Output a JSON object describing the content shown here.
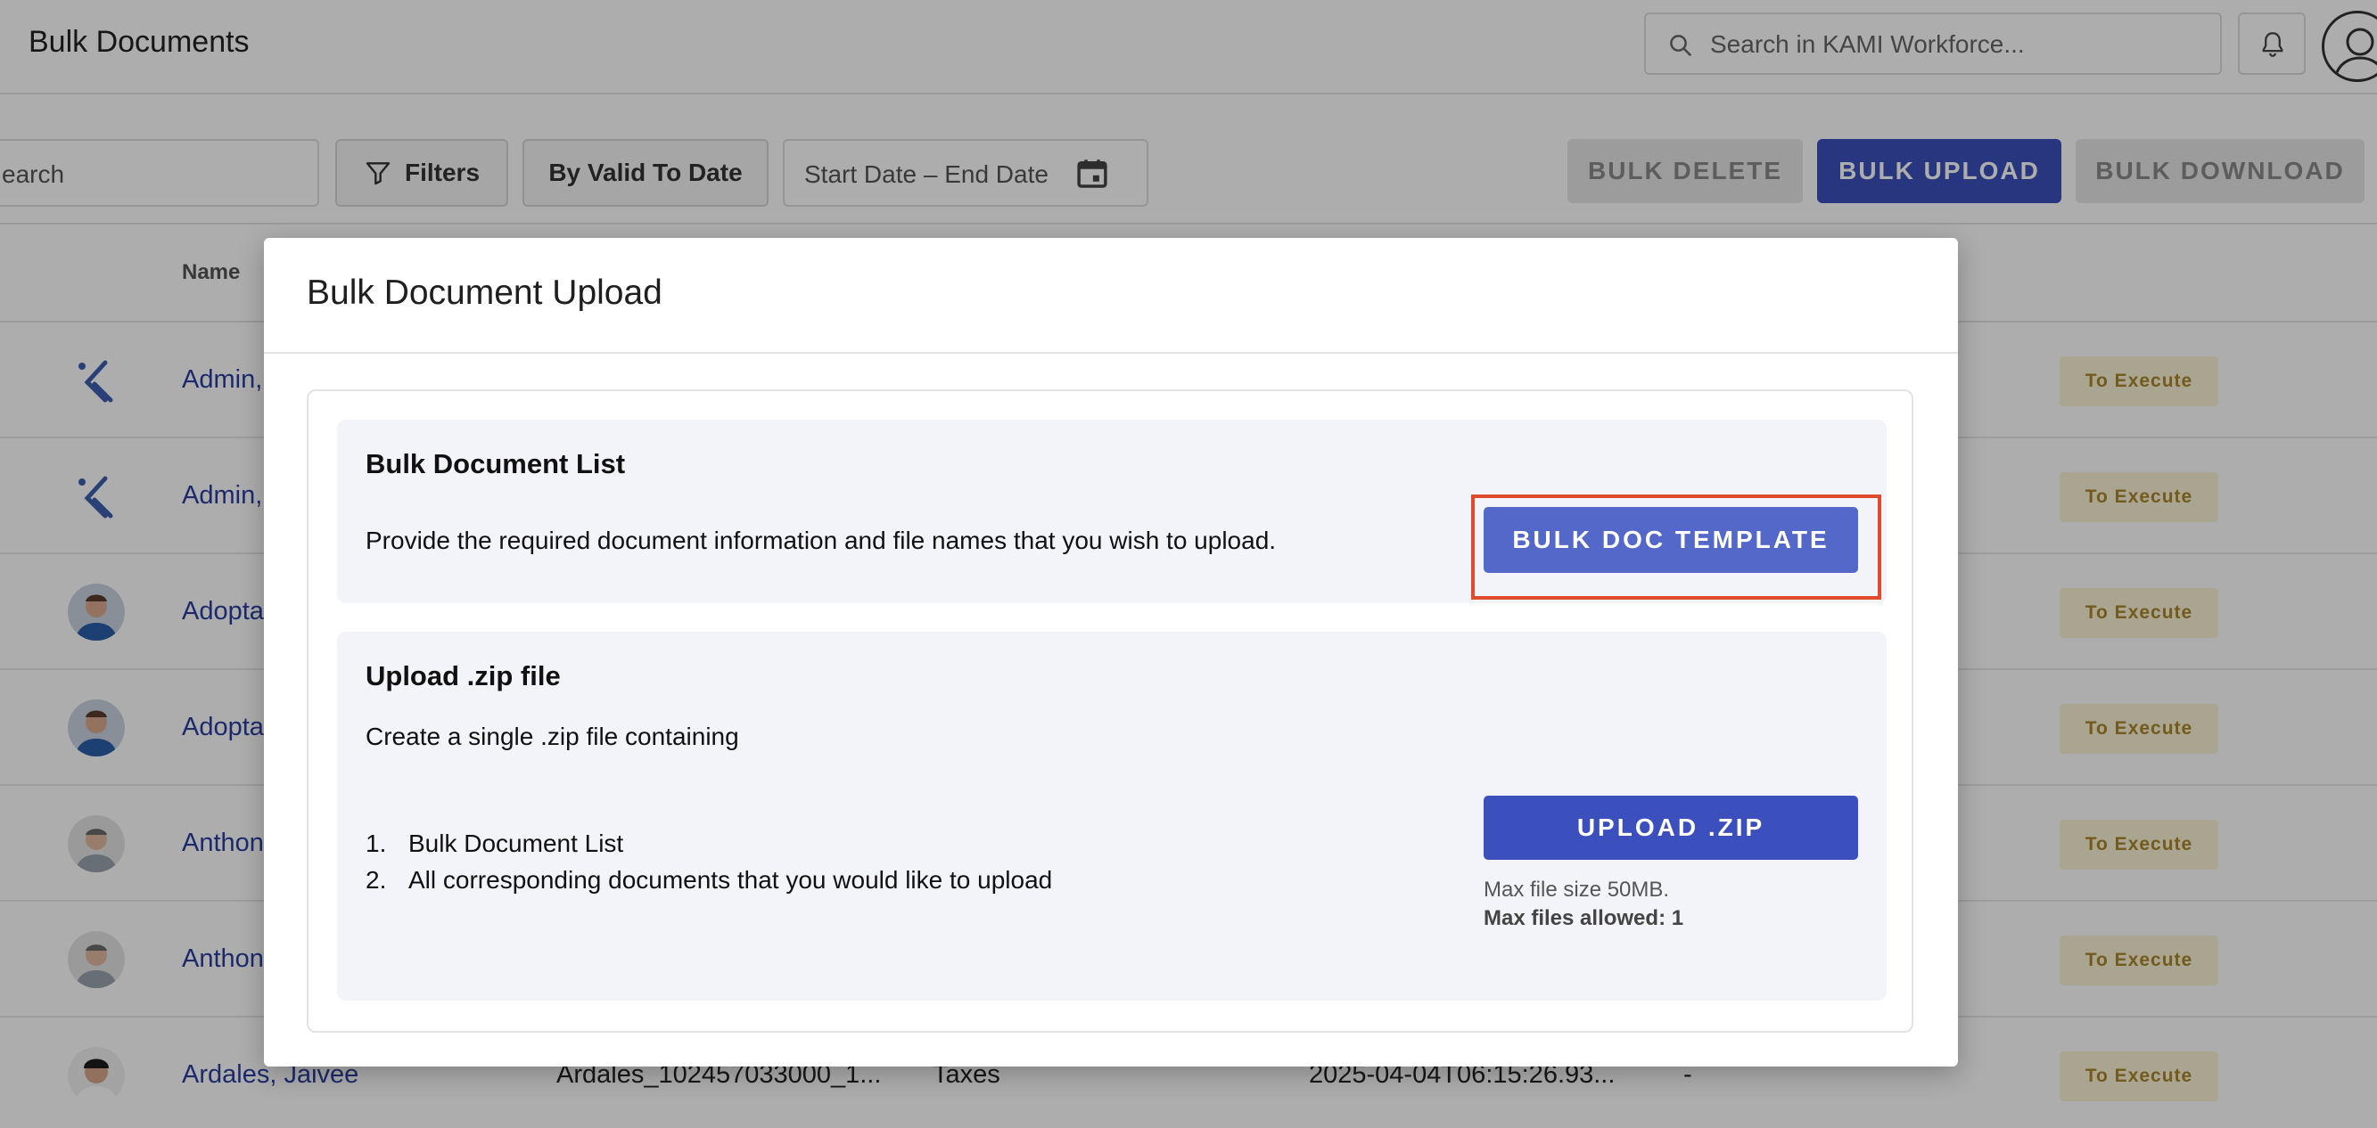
{
  "app": {
    "title": "Bulk Documents",
    "search_placeholder": "Search in KAMI Workforce..."
  },
  "toolbar": {
    "search_text": "earch",
    "filters_label": "Filters",
    "by_valid_label": "By Valid To Date",
    "date_start": "Start Date",
    "date_sep": "–",
    "date_end": "End Date",
    "bulk_delete": "BULK DELETE",
    "bulk_upload": "BULK UPLOAD",
    "bulk_download": "BULK DOWNLOAD"
  },
  "table": {
    "col_name": "Name",
    "rows": [
      {
        "name": "Admin,",
        "c2": "",
        "c3": "",
        "c4": "",
        "c5": "",
        "status": "To Execute"
      },
      {
        "name": "Admin,",
        "c2": "",
        "c3": "",
        "c4": "",
        "c5": "",
        "status": "To Execute"
      },
      {
        "name": "Adopta",
        "c2": "",
        "c3": "",
        "c4": "",
        "c5": "",
        "status": "To Execute"
      },
      {
        "name": "Adopta",
        "c2": "",
        "c3": "",
        "c4": "",
        "c5": "",
        "status": "To Execute"
      },
      {
        "name": "Anthon",
        "c2": "",
        "c3": "",
        "c4": "",
        "c5": "",
        "status": "To Execute"
      },
      {
        "name": "Anthon",
        "c2": "",
        "c3": "",
        "c4": "",
        "c5": "",
        "status": "To Execute"
      },
      {
        "name": "Ardales, Jaivee",
        "c2": "Ardales_102457033000_1...",
        "c3": "Taxes",
        "c4": "2025-04-04T06:15:26.93...",
        "c5": "-",
        "status": "To Execute"
      }
    ]
  },
  "modal": {
    "title": "Bulk Document Upload",
    "list_panel": {
      "title": "Bulk Document List",
      "text": "Provide the required document information and file names that you wish to upload.",
      "button": "BULK DOC TEMPLATE"
    },
    "zip_panel": {
      "title": "Upload .zip file",
      "text": "Create a single .zip file containing",
      "items": [
        {
          "num": "1.",
          "text": "Bulk Document List"
        },
        {
          "num": "2.",
          "text": "All corresponding documents that you would like to upload"
        }
      ],
      "button": "UPLOAD .ZIP",
      "max_size": "Max file size 50MB.",
      "max_files": "Max files allowed: 1"
    }
  },
  "colors": {
    "primary": "#3b50bd",
    "highlight": "#e04a2d",
    "status_bg": "#fbf3d6",
    "status_text": "#a8862a"
  }
}
